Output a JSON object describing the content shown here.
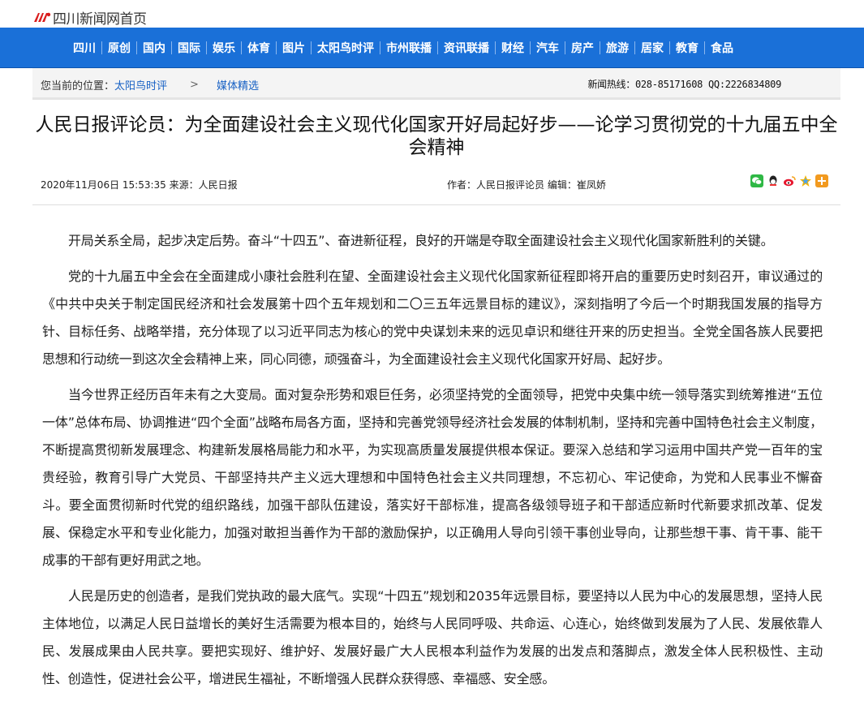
{
  "site": {
    "logo_text": "四川新闻网首页"
  },
  "nav": {
    "items": [
      "四川",
      "原创",
      "国内",
      "国际",
      "娱乐",
      "体育",
      "图片",
      "太阳鸟时评",
      "市州联播",
      "资讯联播",
      "财经",
      "汽车",
      "房产",
      "旅游",
      "居家",
      "教育",
      "食品"
    ]
  },
  "breadcrumb": {
    "label": "您当前的位置：",
    "level1": "太阳鸟时评",
    "arrow": ">",
    "level2": "媒体精选"
  },
  "hotline": {
    "label": "新闻热线：",
    "value": "028-85171608 QQ:2226834809"
  },
  "article": {
    "title": "人民日报评论员：为全面建设社会主义现代化国家开好局起好步——论学习贯彻党的十九届五中全会精神",
    "datetime": "2020年11月06日 15:53:35",
    "source_label": "来源：",
    "source": "人民日报",
    "author_label": "作者：",
    "author": "人民日报评论员",
    "editor_label": "编辑：",
    "editor": "崔凤娇",
    "paragraphs": [
      "开局关系全局，起步决定后势。奋斗“十四五”、奋进新征程，良好的开端是夺取全面建设社会主义现代化国家新胜利的关键。",
      "党的十九届五中全会在全面建成小康社会胜利在望、全面建设社会主义现代化国家新征程即将开启的重要历史时刻召开，审议通过的《中共中央关于制定国民经济和社会发展第十四个五年规划和二〇三五年远景目标的建议》，深刻指明了今后一个时期我国发展的指导方针、目标任务、战略举措，充分体现了以习近平同志为核心的党中央谋划未来的远见卓识和继往开来的历史担当。全党全国各族人民要把思想和行动统一到这次全会精神上来，同心同德，顽强奋斗，为全面建设社会主义现代化国家开好局、起好步。",
      "当今世界正经历百年未有之大变局。面对复杂形势和艰巨任务，必须坚持党的全面领导，把党中央集中统一领导落实到统筹推进“五位一体”总体布局、协调推进“四个全面”战略布局各方面，坚持和完善党领导经济社会发展的体制机制，坚持和完善中国特色社会主义制度，不断提高贯彻新发展理念、构建新发展格局能力和水平，为实现高质量发展提供根本保证。要深入总结和学习运用中国共产党一百年的宝贵经验，教育引导广大党员、干部坚持共产主义远大理想和中国特色社会主义共同理想，不忘初心、牢记使命，为党和人民事业不懈奋斗。要全面贯彻新时代党的组织路线，加强干部队伍建设，落实好干部标准，提高各级领导班子和干部适应新时代新要求抓改革、促发展、保稳定水平和专业化能力，加强对敢担当善作为干部的激励保护，以正确用人导向引领干事创业导向，让那些想干事、肯干事、能干成事的干部有更好用武之地。",
      "人民是历史的创造者，是我们党执政的最大底气。实现“十四五”规划和2035年远景目标，要坚持以人民为中心的发展思想，坚持人民主体地位，以满足人民日益增长的美好生活需要为根本目的，始终与人民同呼吸、共命运、心连心，始终做到发展为了人民、发展依靠人民、发展成果由人民共享。要把实现好、维护好、发展好最广大人民根本利益作为发展的出发点和落脚点，激发全体人民积极性、主动性、创造性，促进社会公平，增进民生福祉，不断增强人民群众获得感、幸福感、安全感。"
    ]
  },
  "share_icons": [
    "wechat-icon",
    "qq-icon",
    "weibo-icon",
    "qzone-icon",
    "more-share-icon"
  ],
  "colors": {
    "nav_bg": "#1a70d8",
    "link": "#1660c4",
    "logo_red": "#d91d1d"
  }
}
